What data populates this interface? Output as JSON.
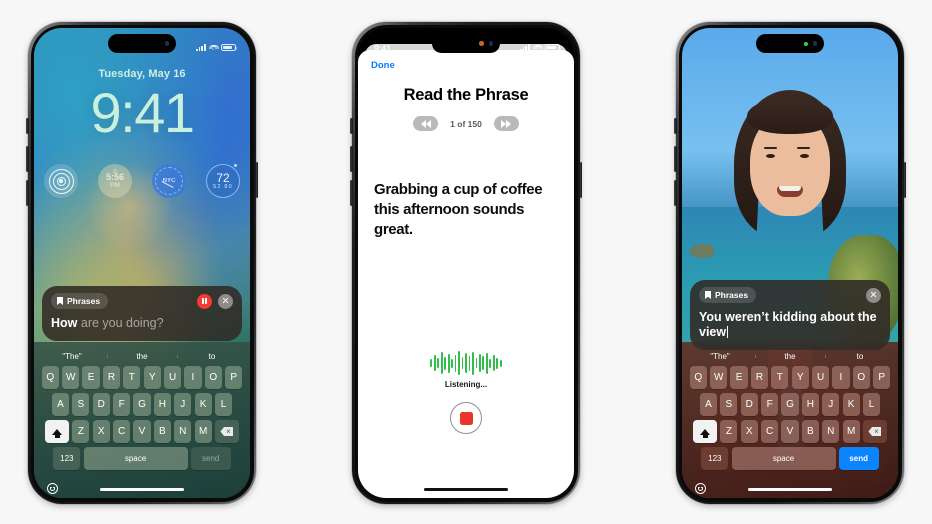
{
  "page": {
    "background_color": "#f7f7f7"
  },
  "phone1": {
    "name": "lock-screen-phrases",
    "status": {
      "signal": "signal-icon",
      "wifi": "wifi-icon",
      "battery": "battery-icon"
    },
    "lock": {
      "date": "Tuesday, May 16",
      "time": "9:41",
      "time_color": "#c8f0dc",
      "widgets": [
        {
          "name": "fitness-rings-widget",
          "label": ""
        },
        {
          "name": "alarm-widget",
          "time": "5:56",
          "meridiem": "PM"
        },
        {
          "name": "world-clock-widget",
          "label": "NYC"
        },
        {
          "name": "weather-widget",
          "temp": "72",
          "range": "52  80"
        }
      ]
    },
    "phrasebar": {
      "chip_label": "Phrases",
      "bookmark_icon": "bookmark-icon",
      "pause_icon": "pause-icon",
      "close_icon": "close-icon",
      "typed_text": "How",
      "suggestion_text": " are you doing?"
    },
    "keyboard": {
      "suggestions": [
        "\"The\"",
        "the",
        "to"
      ],
      "row1": [
        "Q",
        "W",
        "E",
        "R",
        "T",
        "Y",
        "U",
        "I",
        "O",
        "P"
      ],
      "row2": [
        "A",
        "S",
        "D",
        "F",
        "G",
        "H",
        "J",
        "K",
        "L"
      ],
      "row3": [
        "Z",
        "X",
        "C",
        "V",
        "B",
        "N",
        "M"
      ],
      "shift_icon": "shift-icon",
      "delete_icon": "delete-icon",
      "numbers_label": "123",
      "space_label": "space",
      "send_label": "send",
      "send_enabled": false,
      "emoji_icon": "emoji-smiley-icon"
    }
  },
  "phone2": {
    "name": "read-the-phrase-screen",
    "status": {
      "time": "9:41",
      "signal": "signal-icon",
      "wifi": "wifi-icon",
      "battery": "battery-icon"
    },
    "sheet": {
      "done_label": "Done",
      "title": "Read the Phrase",
      "prev_icon": "rewind-icon",
      "next_icon": "fast-forward-icon",
      "counter": "1 of 150",
      "phrase": "Grabbing a cup of coffee this afternoon sounds great.",
      "listening_label": "Listening...",
      "waveform_color": "#2fbf4a",
      "stop_icon": "stop-record-icon",
      "stop_color": "#e8362b"
    }
  },
  "phone3": {
    "name": "facetime-phrases-screen",
    "status": {
      "camera_active": "green-camera-dot"
    },
    "phrasebar": {
      "chip_label": "Phrases",
      "bookmark_icon": "bookmark-icon",
      "close_icon": "close-icon",
      "typed_text": "You weren’t kidding about the view"
    },
    "keyboard": {
      "suggestions": [
        "\"The\"",
        "the",
        "to"
      ],
      "row1": [
        "Q",
        "W",
        "E",
        "R",
        "T",
        "Y",
        "U",
        "I",
        "O",
        "P"
      ],
      "row2": [
        "A",
        "S",
        "D",
        "F",
        "G",
        "H",
        "J",
        "K",
        "L"
      ],
      "row3": [
        "Z",
        "X",
        "C",
        "V",
        "B",
        "N",
        "M"
      ],
      "shift_icon": "shift-icon",
      "delete_icon": "delete-icon",
      "numbers_label": "123",
      "space_label": "space",
      "send_label": "send",
      "send_enabled": true,
      "send_color": "#0a84ff",
      "emoji_icon": "emoji-smiley-icon"
    }
  }
}
